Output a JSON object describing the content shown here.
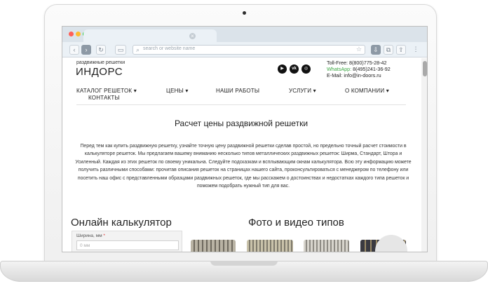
{
  "browser": {
    "address_placeholder": "search or website name",
    "tab_close": "×"
  },
  "header": {
    "brand_sub": "раздвижные решетки",
    "brand": "ИНДОРС",
    "social_icons": [
      "youtube-icon",
      "vk-icon",
      "instagram-icon"
    ],
    "toll_free": "Toll-Free: 8(800)775-28-42",
    "whatsapp_label": "WhatsApp:",
    "whatsapp_phone": "8(495)241-36-92",
    "email": "E-Mail: info@in-doors.ru"
  },
  "nav": {
    "items": [
      "КАТАЛОГ РЕШЕТОК ▾",
      "ЦЕНЫ ▾",
      "НАШИ РАБОТЫ",
      "УСЛУГИ ▾",
      "О КОМПАНИИ ▾",
      "КОНТАКТЫ"
    ]
  },
  "main": {
    "title": "Расчет цены раздвижной решетки",
    "intro": "Перед тем как купить раздвижную решетку, узнайте точную цену раздвижной решетки сделав простой, но предельно точный расчет стоимости в калькуляторе решеток. Мы предлагаем вашему вниманию несколько типов металлических раздвижных решеток: Ширма, Стандарт, Штора и Усиленный. Каждая из этих решеток по своему уникальна. Следуйте подсказкам и всплывающим окнам калькулятора. Всю эту информацию можете получить различными способами: прочитав описания решеток на страницах нашего сайта, проконсультироваться с менеджером по телефону или посетить наш офис с представленными образцами раздвижных решеток, где мы расскажем о достоинствах и недостатках каждого типа решеток и поможем подобрать нужный тип для вас.",
    "calc_title": "Онлайн калькулятор",
    "width_label": "Ширина, мм",
    "required_mark": "*",
    "width_placeholder": "0 мм",
    "gallery_title": "Фото и видео типов"
  },
  "colors": {
    "accent_whatsapp": "#3aa641",
    "dot_red": "#ff5f57",
    "dot_yellow": "#febc2e",
    "dot_green": "#28c840"
  }
}
